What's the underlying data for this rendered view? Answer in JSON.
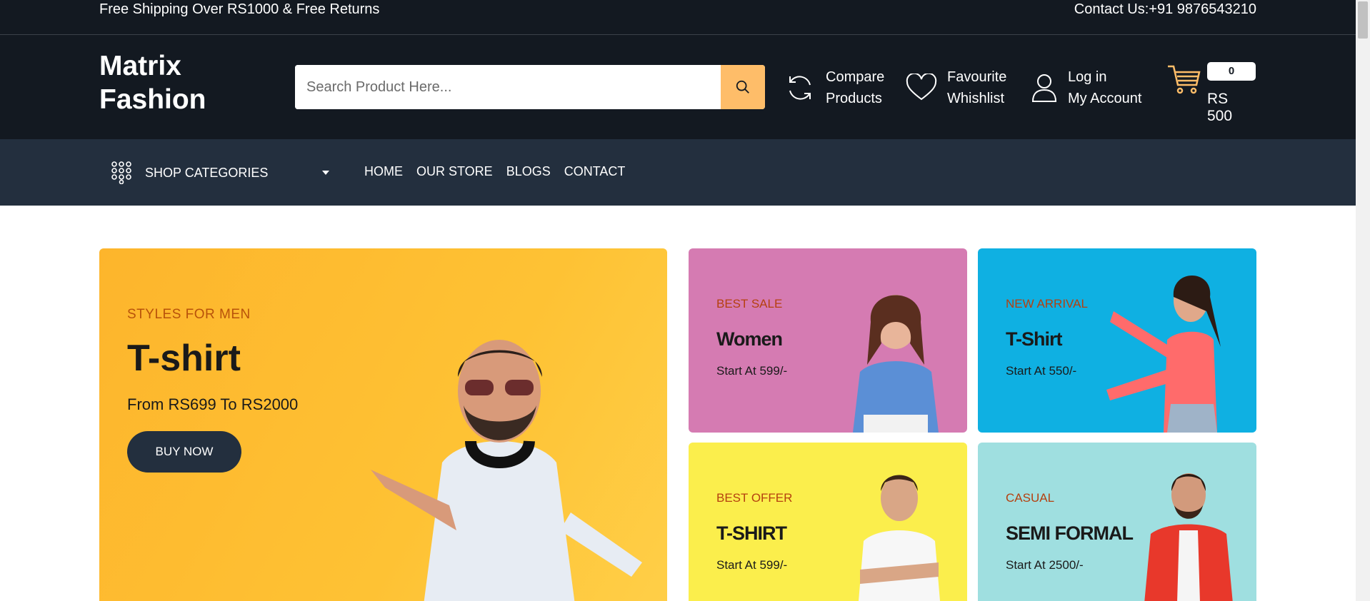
{
  "topbar": {
    "left_text": "Free Shipping Over RS1000 & Free Returns",
    "right_text": "Contact Us:+91 9876543210"
  },
  "header": {
    "logo_line1": "Matrix",
    "logo_line2": "Fashion",
    "search": {
      "placeholder": "Search Product Here...",
      "icon": "search-icon"
    },
    "links": {
      "compare": {
        "line1": "Compare",
        "line2": "Products",
        "icon": "compare-icon"
      },
      "favourite": {
        "line1": "Favourite",
        "line2": "Whishlist",
        "icon": "heart-icon"
      },
      "account": {
        "line1": "Log in",
        "line2": "My Account",
        "icon": "user-icon"
      }
    },
    "cart": {
      "count": "0",
      "amount": "RS 500",
      "icon": "cart-icon"
    }
  },
  "nav": {
    "shop_categories": "SHOP CATEGORIES",
    "items": [
      "HOME",
      "OUR STORE",
      "BLOGS",
      "CONTACT"
    ]
  },
  "banners": {
    "main": {
      "subtitle": "STYLES FOR MEN",
      "title": "T-shirt",
      "price": "From RS699 To RS2000",
      "button": "BUY NOW"
    },
    "small": [
      {
        "subtitle": "BEST SALE",
        "title": "Women",
        "price": "Start At 599/-"
      },
      {
        "subtitle": "NEW ARRIVAL",
        "title": "T-Shirt",
        "price": "Start At 550/-"
      },
      {
        "subtitle": "BEST OFFER",
        "title": "T-SHIRT",
        "price": "Start At 599/-"
      },
      {
        "subtitle": "CASUAL",
        "title": "SEMI FORMAL",
        "price": "Start At 2500/-"
      }
    ]
  },
  "colors": {
    "header_bg": "#131921",
    "nav_bg": "#232f3e",
    "accent": "#febd69",
    "main_banner": "#fdb52c"
  }
}
